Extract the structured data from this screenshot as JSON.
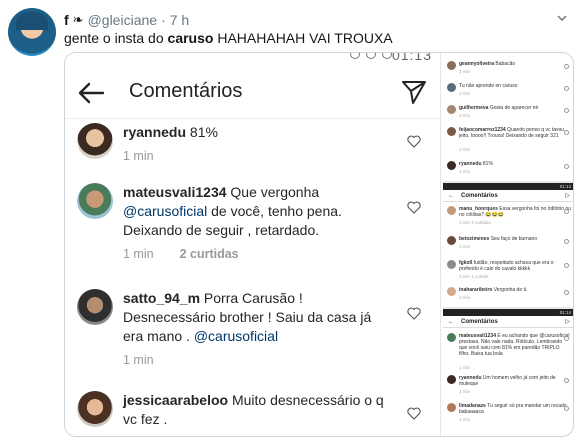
{
  "tweet": {
    "name": "f",
    "handle": "@gleiciane",
    "separator": "·",
    "time": "7 h",
    "text_before": "gente o insta do ",
    "text_bold": "caruso",
    "text_after": " HAHAHAHAH VAI TROUXA"
  },
  "big": {
    "clock": "01:13",
    "title": "Comentários",
    "comments": [
      {
        "user": "ryannedu",
        "text": " 81%",
        "mention": "",
        "text2": "",
        "time": "1 min",
        "likes": ""
      },
      {
        "user": "mateusvali1234",
        "text": " Que vergonha ",
        "mention": "@carusoficial",
        "text2": "  de você, tenho pena. Deixando de seguir , retardado.",
        "time": "1 min",
        "likes": "2 curtidas"
      },
      {
        "user": "satto_94_m",
        "text": " Porra Carusão ! Desnecessário brother ! Saiu da casa já era mano . ",
        "mention": "@carusoficial",
        "text2": "",
        "time": "1 min",
        "likes": ""
      },
      {
        "user": "jessicaarabeloo",
        "text": " Muito desnecessário o q vc fez .",
        "mention": "",
        "text2": "",
        "time": "",
        "likes": ""
      }
    ]
  },
  "side": {
    "top": [
      {
        "user": "geannyoliveira",
        "text": "Babacão",
        "meta": "2 min"
      },
      {
        "user": "",
        "text": "Tu não aprende en caruso",
        "meta": "2 min"
      },
      {
        "user": "guilhermeva",
        "text": "Gosta de aparecer né",
        "meta": "2 min"
      },
      {
        "user": "feijaocomarroz1234",
        "text": "Quando penso q vc tavou jeito, toooo!! Trouxa! Deixando de seguir 321",
        "meta": "2 min"
      },
      {
        "user": "ryannedu",
        "text": "81%",
        "meta": "1 min"
      }
    ],
    "mid_clock": "01:13",
    "mid_title": "Comentários",
    "mid": [
      {
        "user": "manu_honrques",
        "text": "Essa vergonha foi no óditório ou no critilias? 😂😂😂",
        "meta": "2 min   2 curtidas"
      },
      {
        "user": "betozimenes",
        "text": "Seu faço de burnano",
        "meta": "2 min"
      },
      {
        "user": "fgkoll",
        "text": "fuidão, respeitado achava que era o preferido é caio do cavalo kkkkk",
        "meta": "2 min   1 curtida"
      },
      {
        "user": "inahararibeiro",
        "text": "Vergonha de ti.",
        "meta": "2 min"
      }
    ],
    "bot_clock": "01:14",
    "bot_title": "Comentários",
    "bot": [
      {
        "user": "mateusvali1234",
        "text": "E eu achando que @carusoficial prestava. Não vale nada. Ridículo. Lembrando que você saiu com 81% em paredão TRIPLO filho. Baixa tua bola",
        "meta": "1 min"
      },
      {
        "user": "ryannedu",
        "text": "Um homem velho já com jeito de muleque",
        "meta": "1 min"
      },
      {
        "user": "limadanaze",
        "text": "Tu seguir só pra mandar um recado babaaaaca",
        "meta": "1 min"
      }
    ]
  }
}
